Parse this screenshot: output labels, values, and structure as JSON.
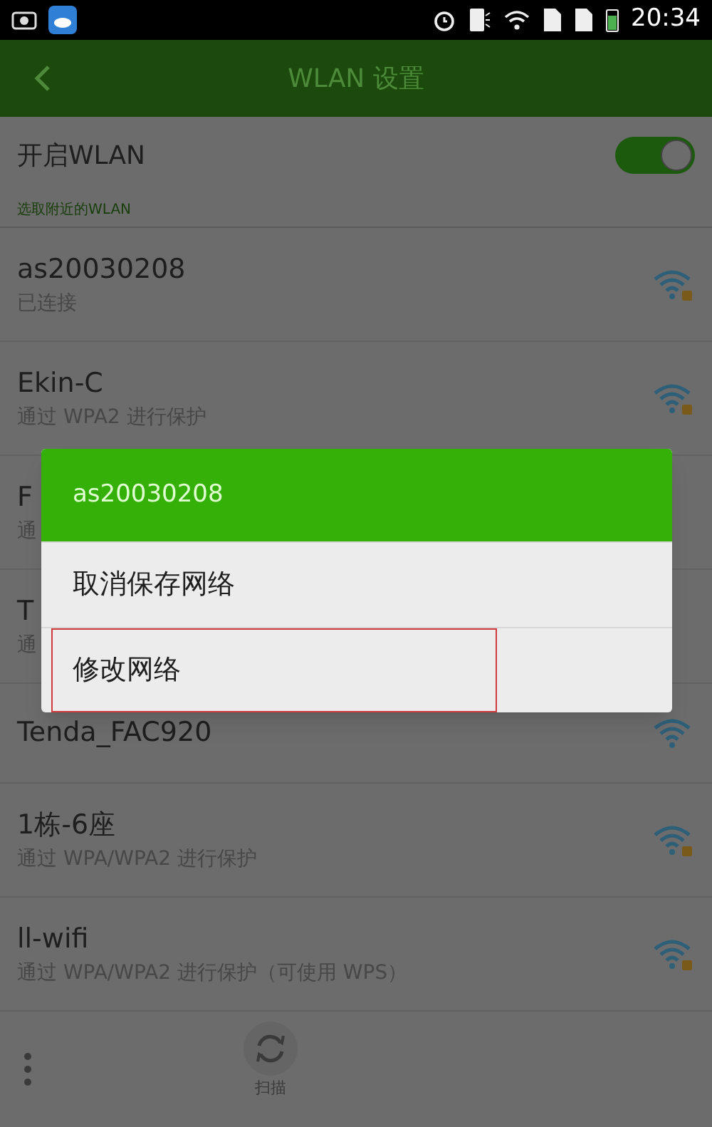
{
  "status_bar": {
    "time": "20:34"
  },
  "header": {
    "title": "WLAN 设置"
  },
  "wlan_toggle": {
    "label": "开启WLAN",
    "on": true
  },
  "section_label": "选取附近的WLAN",
  "networks": [
    {
      "name": "as20030208",
      "status": "已连接",
      "locked": true
    },
    {
      "name": "Ekin-C",
      "status": "通过 WPA2 进行保护",
      "locked": true
    },
    {
      "name": "F",
      "status": "通"
    },
    {
      "name": "T",
      "status": "通"
    },
    {
      "name": "Tenda_FAC920",
      "locked": false
    },
    {
      "name": "1栋-6座",
      "status": "通过 WPA/WPA2 进行保护",
      "locked": true
    },
    {
      "name": "ll-wifi",
      "status": "通过 WPA/WPA2 进行保护（可使用 WPS）",
      "locked": true
    }
  ],
  "bottom_bar": {
    "scan_label": "扫描"
  },
  "dialog": {
    "title": "as20030208",
    "items": [
      {
        "label": "取消保存网络",
        "highlighted": false
      },
      {
        "label": "修改网络",
        "highlighted": true
      }
    ]
  }
}
